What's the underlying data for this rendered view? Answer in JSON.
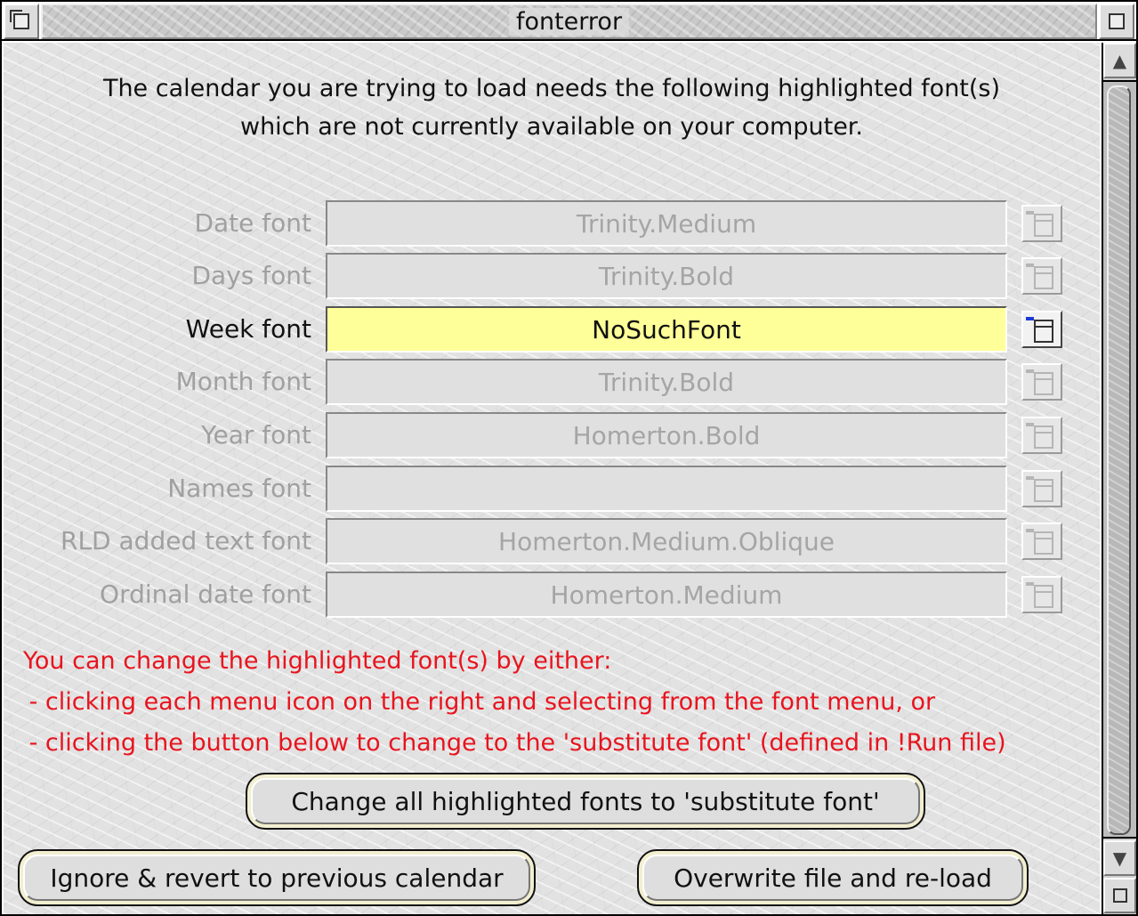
{
  "window": {
    "title": "fonterror"
  },
  "intro": {
    "line1": "The calendar you are trying to load needs the following highlighted font(s)",
    "line2": "which are not currently available on your computer."
  },
  "fonts": [
    {
      "label": "Date font",
      "value": "Trinity.Medium",
      "highlighted": false
    },
    {
      "label": "Days font",
      "value": "Trinity.Bold",
      "highlighted": false
    },
    {
      "label": "Week font",
      "value": "NoSuchFont",
      "highlighted": true
    },
    {
      "label": "Month font",
      "value": "Trinity.Bold",
      "highlighted": false
    },
    {
      "label": "Year font",
      "value": "Homerton.Bold",
      "highlighted": false
    },
    {
      "label": "Names font",
      "value": "",
      "highlighted": false
    },
    {
      "label": "RLD added text font",
      "value": "Homerton.Medium.Oblique",
      "highlighted": false
    },
    {
      "label": "Ordinal date font",
      "value": "Homerton.Medium",
      "highlighted": false
    }
  ],
  "help": {
    "line1": "You can change the highlighted font(s) by either:",
    "line2": " - clicking each menu icon on the right and selecting from the font menu, or",
    "line3": " - clicking the button below to change to the 'substitute font' (defined in !Run file)"
  },
  "buttons": {
    "substitute": "Change all highlighted fonts to 'substitute font'",
    "ignore": "Ignore & revert to previous calendar",
    "overwrite": "Overwrite file and re-load"
  },
  "icons": {
    "back": "back-icon",
    "toggle_size": "toggle-size-icon",
    "scroll_up": "scroll-up-arrow-icon",
    "scroll_down": "scroll-down-arrow-icon",
    "adjust_size": "adjust-size-icon",
    "menu": "menu-icon"
  },
  "colors": {
    "highlight_field": "#ffff99",
    "help_text": "#e8141e",
    "menu_arrow_active": "#1b3cd8",
    "button_outline": "#f2eed0"
  }
}
